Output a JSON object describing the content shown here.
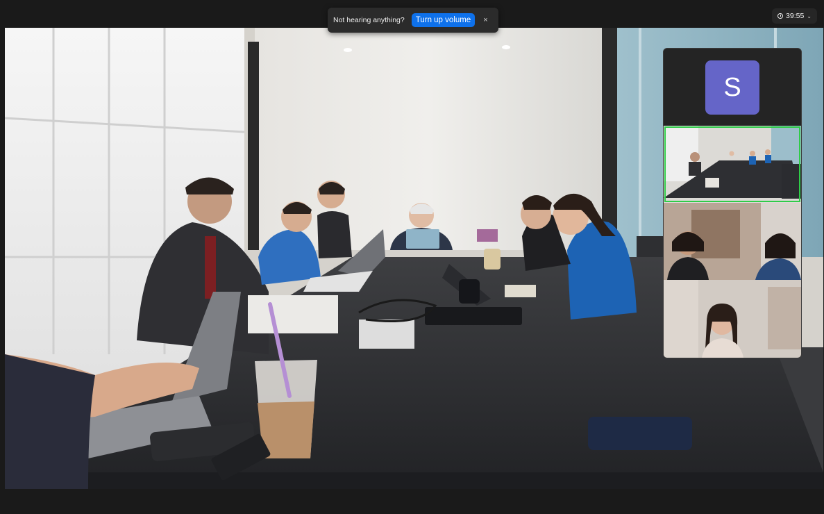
{
  "notice": {
    "message": "Not hearing anything?",
    "action_label": "Turn up volume",
    "close_symbol": "×"
  },
  "timer": {
    "elapsed": "39:55",
    "chevron": "⌄"
  },
  "gallery": {
    "participants": [
      {
        "avatar_initial": "S",
        "avatar_color": "#6565c8",
        "speaking": false
      },
      {
        "speaking": true,
        "highlight_color": "#2fcc48"
      },
      {
        "speaking": false
      },
      {
        "speaking": false
      }
    ]
  },
  "colors": {
    "accent": "#0e71eb",
    "background": "#1a1a1a"
  }
}
